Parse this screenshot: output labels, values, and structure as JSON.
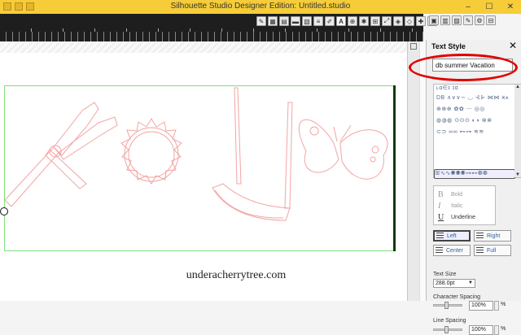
{
  "window": {
    "title": "Silhouette Studio Designer Edition: Untitled.studio",
    "minimize": "–",
    "maximize": "☐",
    "close": "✕"
  },
  "toolbar": {
    "text_tool_label": "A"
  },
  "panel": {
    "title": "Text Style",
    "close": "✕",
    "font_name": "db summer Vacation",
    "fonts": [
      {
        "label": "ʟɑ∈ɪ ɪɑ"
      },
      {
        "label": "DB ∧∨∨∼ ◟◞ ⊰⊱ ⋈⋈ ⩙⩚"
      },
      {
        "label": "⊕⊕⊕ ✿✿ ⋯ ◎◎"
      },
      {
        "label": "◍◍◍ ⊙⊙⊙ ◐◑ ⊗⊗"
      },
      {
        "label": "⊂⊃ ∞∞ ⊷⊶ ≋≋"
      },
      {
        "label": "ꕥ∿∿◉◉◉⊶⊷◍◍"
      }
    ],
    "styles": {
      "bold": {
        "icon": "B",
        "label": "Bold"
      },
      "italic": {
        "icon": "I",
        "label": "Italic"
      },
      "underline": {
        "icon": "U",
        "label": "Underline"
      }
    },
    "align": {
      "left": "Left",
      "right": "Right",
      "center": "Center",
      "full": "Full"
    },
    "text_size_label": "Text Size",
    "text_size_value": "288.0pt",
    "character_spacing_label": "Character Spacing",
    "character_spacing_value": "100%",
    "line_spacing_label": "Line Spacing",
    "line_spacing_value": "100%",
    "percent": "%"
  },
  "canvas": {
    "watermark": "underacherrytree.com",
    "shape_color": "#f3a4a4",
    "box_color": "#7ee07a"
  },
  "accent": {
    "title_bar": "#f6cd39",
    "highlight_ring": "#e00000"
  }
}
